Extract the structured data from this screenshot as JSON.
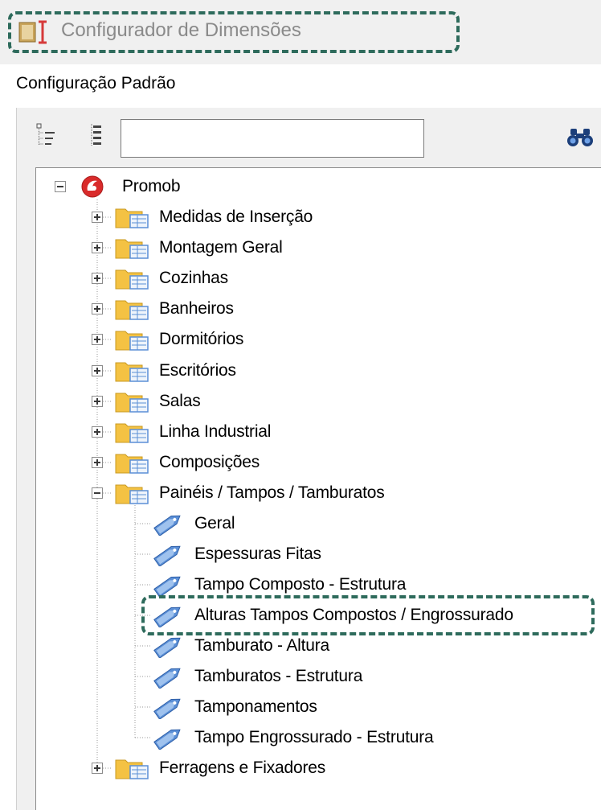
{
  "window": {
    "title": "Configurador de Dimensões",
    "icon": "ruler-book-icon"
  },
  "config": {
    "label": "Configuração Padrão"
  },
  "toolbar": {
    "expand_icon": "tree-expand-icon",
    "list_icon": "tree-list-icon",
    "search": {
      "value": "",
      "placeholder": ""
    },
    "find_icon": "binoculars-icon"
  },
  "tree": {
    "root": {
      "label": "Promob",
      "icon": "promob-logo-icon",
      "expanded": true
    },
    "folders": [
      {
        "label": "Medidas de Inserção",
        "expanded": false
      },
      {
        "label": "Montagem Geral",
        "expanded": false
      },
      {
        "label": "Cozinhas",
        "expanded": false
      },
      {
        "label": "Banheiros",
        "expanded": false
      },
      {
        "label": "Dormitórios",
        "expanded": false
      },
      {
        "label": "Escritórios",
        "expanded": false
      },
      {
        "label": "Salas",
        "expanded": false
      },
      {
        "label": "Linha Industrial",
        "expanded": false
      },
      {
        "label": "Composições",
        "expanded": false
      },
      {
        "label": "Painéis / Tampos / Tamburatos",
        "expanded": true
      },
      {
        "label": "Ferragens e Fixadores",
        "expanded": false
      }
    ],
    "expanded_folder_items": [
      {
        "label": "Geral",
        "icon": "tag-icon"
      },
      {
        "label": "Espessuras Fitas",
        "icon": "tag-icon"
      },
      {
        "label": "Tampo Composto - Estrutura",
        "icon": "tag-icon"
      },
      {
        "label": "Alturas Tampos Compostos / Engrossurado",
        "icon": "tag-icon",
        "highlighted": true
      },
      {
        "label": "Tamburato - Altura",
        "icon": "tag-icon"
      },
      {
        "label": "Tamburatos - Estrutura",
        "icon": "tag-icon"
      },
      {
        "label": "Tamponamentos",
        "icon": "tag-icon"
      },
      {
        "label": "Tampo Engrossurado - Estrutura",
        "icon": "tag-icon"
      }
    ]
  },
  "colors": {
    "highlight_border": "#2e6b5c",
    "folder": "#f4c243",
    "tag": "#5b8fd6",
    "promob_red": "#d92b2b"
  }
}
